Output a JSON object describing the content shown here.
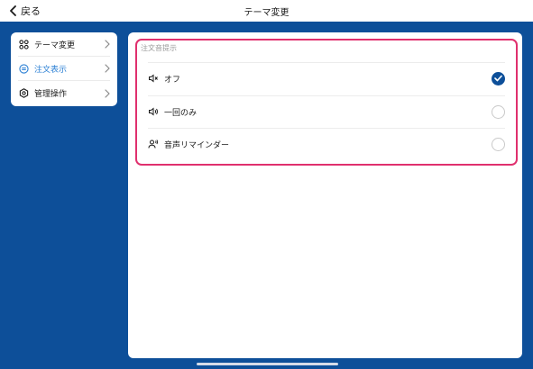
{
  "header": {
    "back_label": "戻る",
    "title": "テーマ変更"
  },
  "sidebar": {
    "items": [
      {
        "label": "テーマ変更",
        "icon": "grid-icon",
        "active": false
      },
      {
        "label": "注文表示",
        "icon": "list-circle-icon",
        "active": true
      },
      {
        "label": "管理操作",
        "icon": "gear-icon",
        "active": false
      }
    ]
  },
  "main": {
    "section_title": "注文音提示",
    "options": [
      {
        "label": "オフ",
        "icon": "speaker-mute-icon",
        "checked": true
      },
      {
        "label": "一回のみ",
        "icon": "speaker-icon",
        "checked": false
      },
      {
        "label": "音声リマインダー",
        "icon": "person-voice-icon",
        "checked": false
      }
    ]
  },
  "colors": {
    "background": "#0d4f99",
    "accent": "#2a7fd4",
    "highlight_border": "#e0306e",
    "checked_radio": "#0d4f99"
  }
}
